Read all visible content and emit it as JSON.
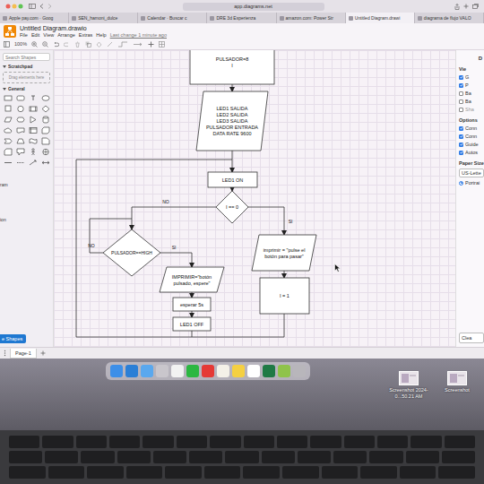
{
  "browser": {
    "url": "app.diagrams.net",
    "tabs": [
      {
        "label": "Apple pay.com · Goog",
        "selected": false
      },
      {
        "label": "SEN_hamoni_dulce",
        "selected": false
      },
      {
        "label": "Calendar · Buscar c",
        "selected": false
      },
      {
        "label": "DRE 3d Esperienza",
        "selected": false
      },
      {
        "label": "amazon.com: Power Str",
        "selected": false
      },
      {
        "label": "Untitled Diagram.drawi",
        "selected": true
      },
      {
        "label": "diagrama de flujo VALO",
        "selected": false
      }
    ]
  },
  "app": {
    "title": "Untitled Diagram.drawio",
    "menus": [
      "File",
      "Edit",
      "View",
      "Arrange",
      "Extras",
      "Help"
    ],
    "last_change": "Last change 1 minute ago",
    "zoom": "100%"
  },
  "sidebar": {
    "search_placeholder": "Search Shapes",
    "scratchpad": {
      "label": "Scratchpad",
      "expanded": true,
      "hint": "Drag elements here"
    },
    "general": {
      "label": "General",
      "expanded": true
    },
    "cut_labels": [
      "ram",
      "ion"
    ],
    "more_shapes": "e Shapes"
  },
  "diagram": {
    "nodes": [
      {
        "kind": "rect",
        "lines": [
          "PULSADOR=8",
          "I"
        ]
      },
      {
        "kind": "para",
        "lines": [
          "LED1 SALIDA",
          "LED2 SALIDA",
          "LED3 SALIDA",
          "PULSADOR ENTRADA",
          "DATA RATE 9600"
        ]
      },
      {
        "kind": "rect",
        "lines": [
          "LED1 ON"
        ]
      },
      {
        "kind": "diamond",
        "lines": [
          "I == 0"
        ]
      },
      {
        "kind": "diamond",
        "lines": [
          "PULSADOR==HIGH"
        ]
      },
      {
        "kind": "para",
        "lines": [
          "imprimir = \"pulse el",
          "botón para pasar\""
        ]
      },
      {
        "kind": "rect",
        "lines": [
          "I = 1"
        ]
      },
      {
        "kind": "para",
        "lines": [
          "IMPRIMIR=\"botón",
          "pulsado, espere\""
        ]
      },
      {
        "kind": "rect",
        "lines": [
          "esperar 5s"
        ]
      },
      {
        "kind": "rect",
        "lines": [
          "LED1 OFF"
        ]
      }
    ],
    "edge_labels": [
      "NO",
      "SI",
      "NO",
      "SI"
    ]
  },
  "right_panel": {
    "tab": "D",
    "view_title": "Vie",
    "view_options": [
      {
        "label": "G",
        "checked": true,
        "disabled": false
      },
      {
        "label": "P",
        "checked": true,
        "disabled": false
      },
      {
        "label": "Ba",
        "checked": false,
        "disabled": false
      },
      {
        "label": "Ba",
        "checked": false,
        "disabled": false
      },
      {
        "label": "Sha",
        "checked": false,
        "disabled": true
      }
    ],
    "options_title": "Options",
    "options": [
      {
        "label": "Conn",
        "checked": true
      },
      {
        "label": "Conn",
        "checked": true
      },
      {
        "label": "Guide",
        "checked": true
      },
      {
        "label": "Autos",
        "checked": true
      }
    ],
    "paper_title": "Paper Size",
    "paper_size": "US-Lette",
    "orientation": [
      {
        "label": "Portrai",
        "selected": true
      }
    ],
    "button": "Clea"
  },
  "pages": [
    {
      "label": "Page-1",
      "selected": true
    }
  ],
  "dock": {
    "apps": [
      {
        "color": "#3d8fe8"
      },
      {
        "color": "#2b7fd6"
      },
      {
        "color": "#5aa8ee"
      },
      {
        "color": "#c9c6cc"
      },
      {
        "color": "#f2f2f2"
      },
      {
        "color": "#2bb741"
      },
      {
        "color": "#e53935"
      },
      {
        "color": "#f4f1e8"
      },
      {
        "color": "#f5d042"
      },
      {
        "color": "#ffffff"
      },
      {
        "color": "#1f7a45"
      },
      {
        "color": "#8fc34a"
      },
      {
        "color": "#b8b6bb"
      }
    ]
  },
  "desktop": {
    "files": [
      {
        "label": "Screenshot 2024-0...50.21 AM"
      },
      {
        "label": "Screenshot"
      }
    ]
  }
}
